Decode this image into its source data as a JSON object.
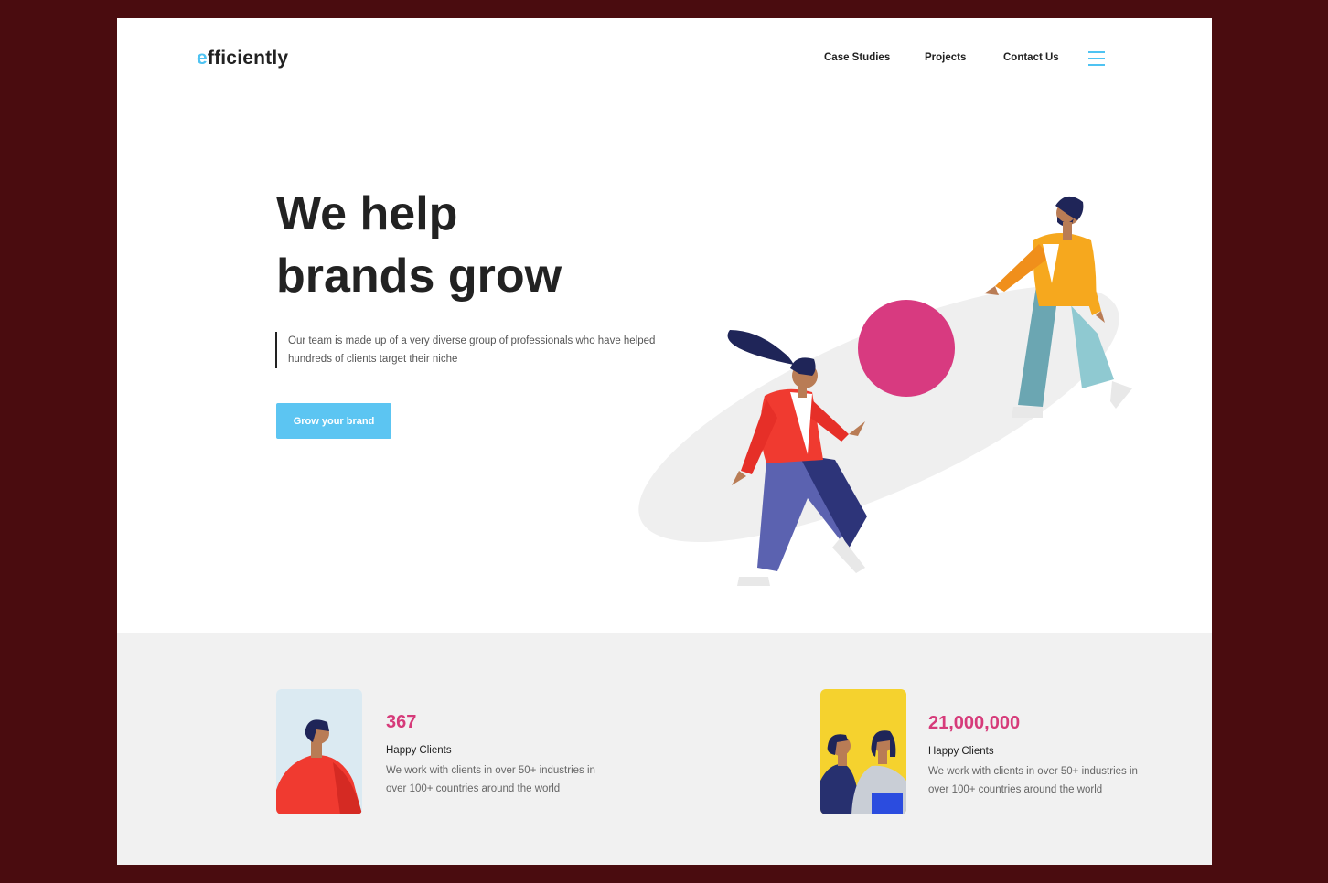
{
  "header": {
    "logo_first": "e",
    "logo_rest": "fficiently",
    "nav": [
      "Case Studies",
      "Projects",
      "Contact Us"
    ],
    "menu_icon": "hamburger-menu-icon"
  },
  "hero": {
    "title_line1": "We help",
    "title_line2": "brands grow",
    "subtitle": "Our team is made up of a very diverse group of professionals who have helped hundreds of clients target their niche",
    "cta_label": "Grow your brand"
  },
  "stats": [
    {
      "value": "367",
      "label": "Happy Clients",
      "description": "We work with clients in over 50+ industries in over 100+ countries around the world"
    },
    {
      "value": "21,000,000",
      "label": "Happy Clients",
      "description": "We work with clients in over 50+ industries in over 100+ countries around the world"
    }
  ],
  "colors": {
    "accent": "#4fc3f2",
    "cta": "#5cc5f2",
    "stat_number": "#d63b7a",
    "ball": "#d83a80",
    "page_background": "#4a0c0f",
    "stats_background": "#f1f1f1"
  }
}
